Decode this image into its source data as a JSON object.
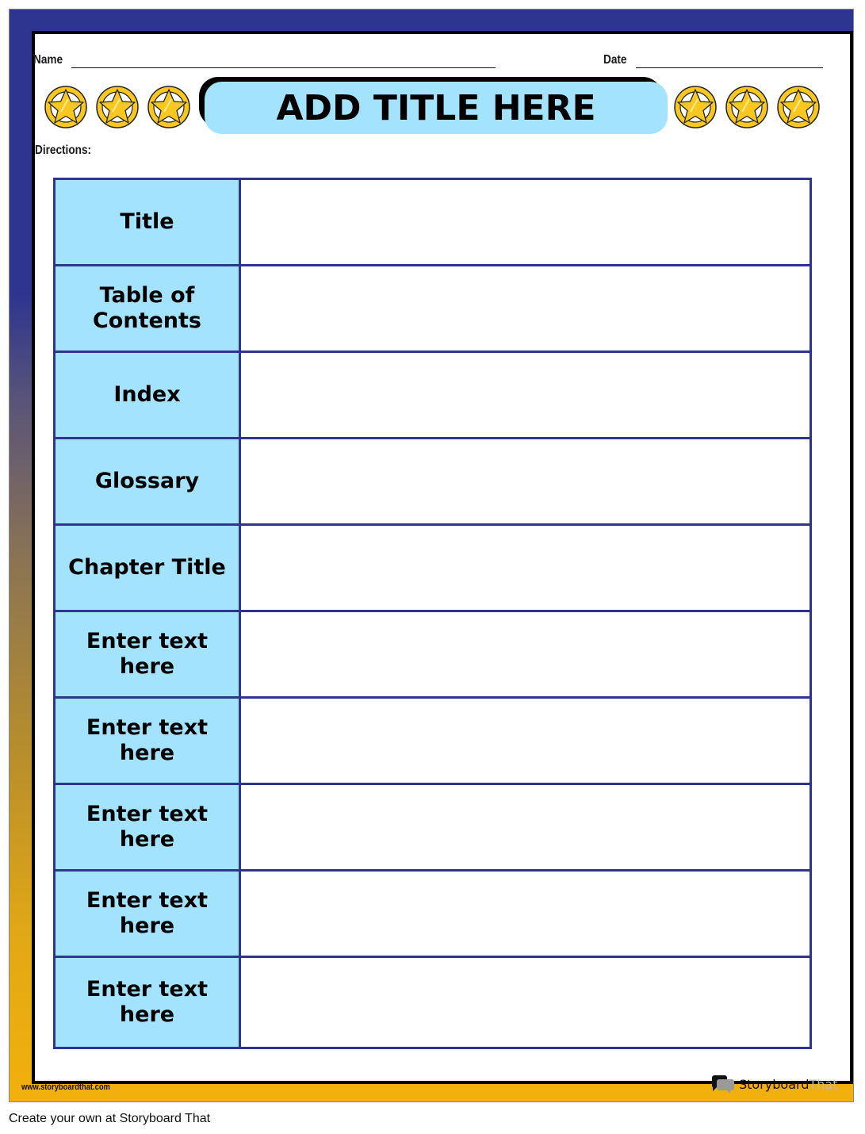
{
  "worksheet": {
    "name_label": "Name",
    "date_label": "Date",
    "directions_label": "Directions:",
    "title": "ADD TITLE HERE",
    "decoration": {
      "left_icons": [
        "star-badge-icon",
        "star-badge-icon",
        "star-badge-icon"
      ],
      "right_icons": [
        "star-badge-icon",
        "star-badge-icon",
        "star-badge-icon"
      ]
    },
    "colors": {
      "navy": "#2e3590",
      "gold": "#f2b00c",
      "light_blue": "#a4e3fd",
      "star_gold": "#f8c820"
    },
    "table": {
      "rows": [
        {
          "label": "Title",
          "value": ""
        },
        {
          "label": "Table of Contents",
          "value": ""
        },
        {
          "label": "Index",
          "value": ""
        },
        {
          "label": "Glossary",
          "value": ""
        },
        {
          "label": "Chapter Title",
          "value": ""
        },
        {
          "label": "Enter text here",
          "value": ""
        },
        {
          "label": "Enter text here",
          "value": ""
        },
        {
          "label": "Enter text here",
          "value": ""
        },
        {
          "label": "Enter text here",
          "value": ""
        },
        {
          "label": "Enter text here",
          "value": ""
        }
      ]
    }
  },
  "footer": {
    "url": "www.storyboardthat.com",
    "brand_main": "Storyboard",
    "brand_accent": "That",
    "caption": "Create your own at Storyboard That"
  }
}
